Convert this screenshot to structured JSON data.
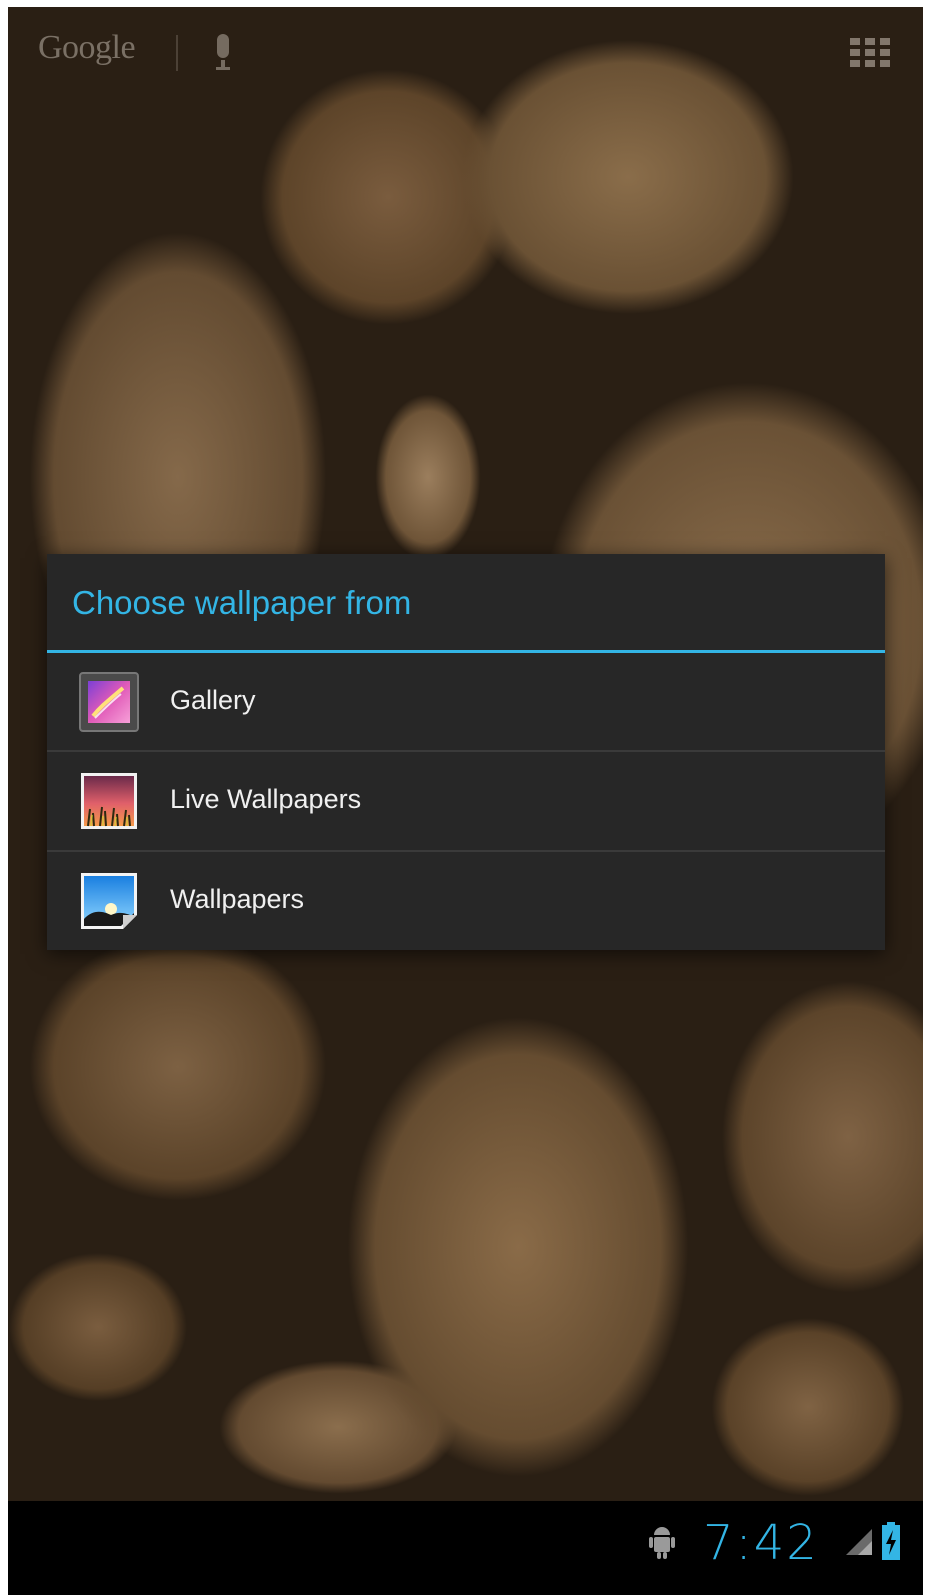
{
  "home_screen": {
    "search_logo_text": "Google",
    "icons": {
      "voice_search": "mic-icon",
      "app_drawer": "apps-grid-icon"
    }
  },
  "dialog": {
    "title": "Choose wallpaper from",
    "accent_color": "#33b5e5",
    "options": [
      {
        "label": "Gallery",
        "icon": "gallery-icon"
      },
      {
        "label": "Live Wallpapers",
        "icon": "live-wallpapers-icon"
      },
      {
        "label": "Wallpapers",
        "icon": "wallpapers-icon"
      }
    ]
  },
  "status_bar": {
    "time": "7:42",
    "icons": [
      "android-debug-icon",
      "signal-icon",
      "battery-charging-icon"
    ]
  }
}
